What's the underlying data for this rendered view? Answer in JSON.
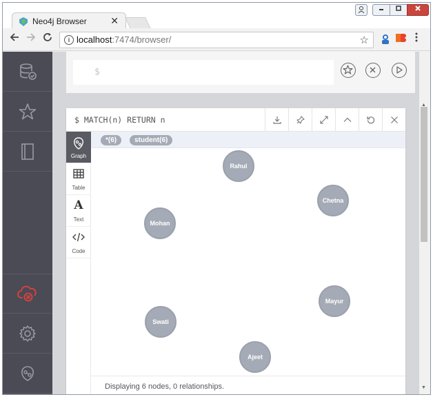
{
  "browser": {
    "tab_title": "Neo4j Browser",
    "tab_close": "✕",
    "url_host": "localhost",
    "url_path": ":7474/browser/"
  },
  "editor": {
    "prompt": "$"
  },
  "frame": {
    "query": "$ MATCH(n) RETURN n",
    "view_tabs": [
      {
        "label": "Graph"
      },
      {
        "label": "Table"
      },
      {
        "label": "Text"
      },
      {
        "label": "Code"
      }
    ],
    "legend": [
      {
        "label": "*(6)"
      },
      {
        "label": "student(6)"
      }
    ],
    "nodes": [
      {
        "name": "Rahul"
      },
      {
        "name": "Chetna"
      },
      {
        "name": "Mohan"
      },
      {
        "name": "Mayur"
      },
      {
        "name": "Swati"
      },
      {
        "name": "Ajeet"
      }
    ],
    "status": "Displaying 6 nodes, 0 relationships."
  },
  "colors": {
    "sidebar_bg": "#4b4b55",
    "node_fill": "#a5abb6",
    "alert_red": "#e0403b"
  }
}
